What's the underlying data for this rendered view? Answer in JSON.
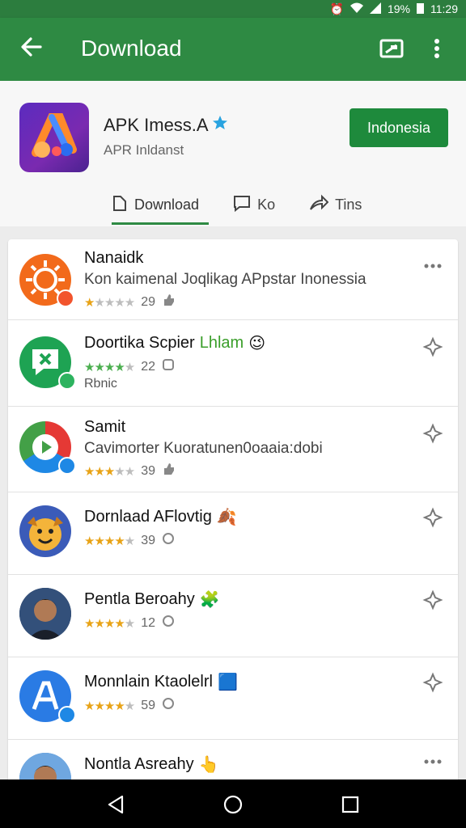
{
  "status_bar": {
    "alarm_icon": "alarm-icon",
    "wifi_icon": "wifi-icon",
    "signal_icon": "signal-icon",
    "battery": "19%",
    "time": "11:29"
  },
  "app_bar": {
    "title": "Download",
    "back_icon": "arrow-left-icon",
    "action_icon": "cast-icon",
    "menu_icon": "more-vert-icon"
  },
  "app": {
    "name": "APK Imess.A",
    "verified_icon": "verified-star-icon",
    "developer": "APR Inldanst",
    "install_label": "Indonesia"
  },
  "tabs": [
    {
      "label": "Download",
      "icon": "bookmark-icon",
      "active": true
    },
    {
      "label": "Ko",
      "icon": "comment-icon",
      "active": false
    },
    {
      "label": "Tins",
      "icon": "share-icon",
      "active": false
    }
  ],
  "list": [
    {
      "title": "Nanaidk",
      "subtitle": "Kon kaimenal Joqlikag APpstar Inonessia",
      "rating": 1,
      "count": "29",
      "action_icon": "more-horiz-icon",
      "emoji": ""
    },
    {
      "title": "Doortika Scpier",
      "title_extra": "Lhlam",
      "emoji": "😉",
      "rating": 4,
      "count": "22",
      "note": "Rbnic",
      "action_icon": "pin-icon"
    },
    {
      "title": "Samit",
      "subtitle": "Cavimorter Kuoratunen0oaaia:dobi",
      "rating": 3,
      "count": "39",
      "action_icon": "pin-icon",
      "emoji": ""
    },
    {
      "title": "Dornlaad AFlovtig",
      "emoji": "🍂",
      "rating": 4,
      "count": "39",
      "action_icon": "pin-icon"
    },
    {
      "title": "Pentla Beroahy",
      "emoji": "🧩",
      "rating": 4,
      "count": "12",
      "action_icon": "pin-icon"
    },
    {
      "title": "Monnlain Ktaolelrl",
      "emoji": "🟦",
      "rating": 4,
      "count": "59",
      "action_icon": "pin-icon"
    },
    {
      "title": "Nontla Asreahy",
      "emoji": "👆",
      "rating": 0,
      "count": "",
      "action_icon": "more-horiz-icon"
    }
  ],
  "colors": {
    "primary": "#2e8a43",
    "primary_dark": "#2c7d3e",
    "install": "#1e8a3c",
    "star": "#e8a317"
  },
  "nav_bar": {
    "back_icon": "triangle-back-icon",
    "home_icon": "circle-home-icon",
    "recents_icon": "square-recents-icon"
  }
}
